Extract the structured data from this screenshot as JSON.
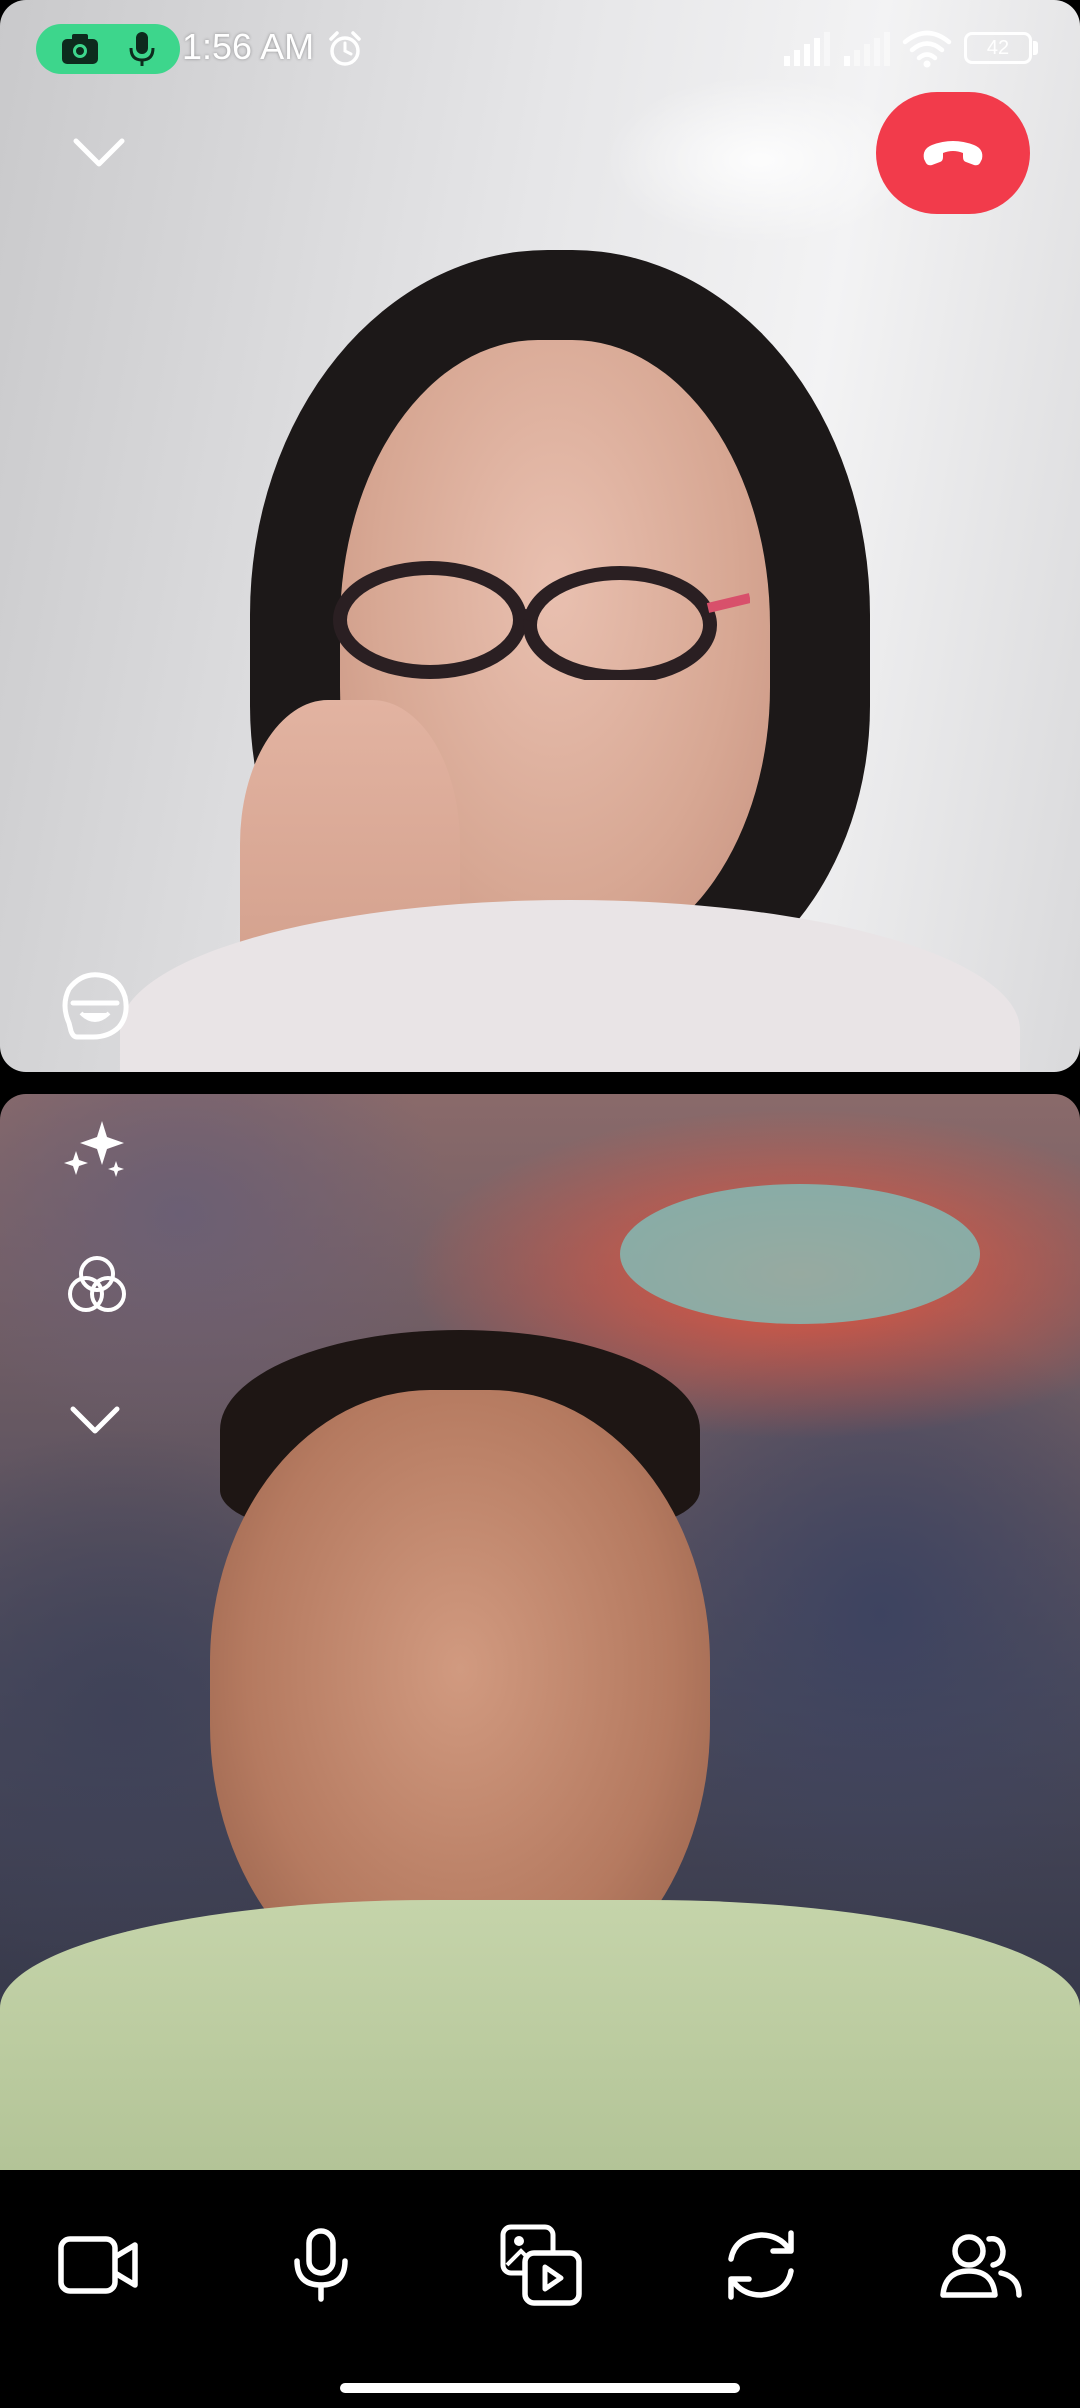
{
  "status_bar": {
    "time": "1:56 AM",
    "battery": "42",
    "recording_indicator_color": "#3dd68c"
  },
  "call": {
    "end_call_color": "#f23b4b"
  },
  "icons": {
    "minimize": "chevron-down-icon",
    "end_call": "phone-hangup-icon",
    "reactions": "sticker-face-icon",
    "effects": "sparkles-icon",
    "filters": "color-circles-icon",
    "collapse_tools": "chevron-down-icon",
    "camera": "video-camera-icon",
    "mic": "microphone-icon",
    "share": "media-share-icon",
    "flip": "camera-switch-icon",
    "participants": "add-people-icon"
  }
}
